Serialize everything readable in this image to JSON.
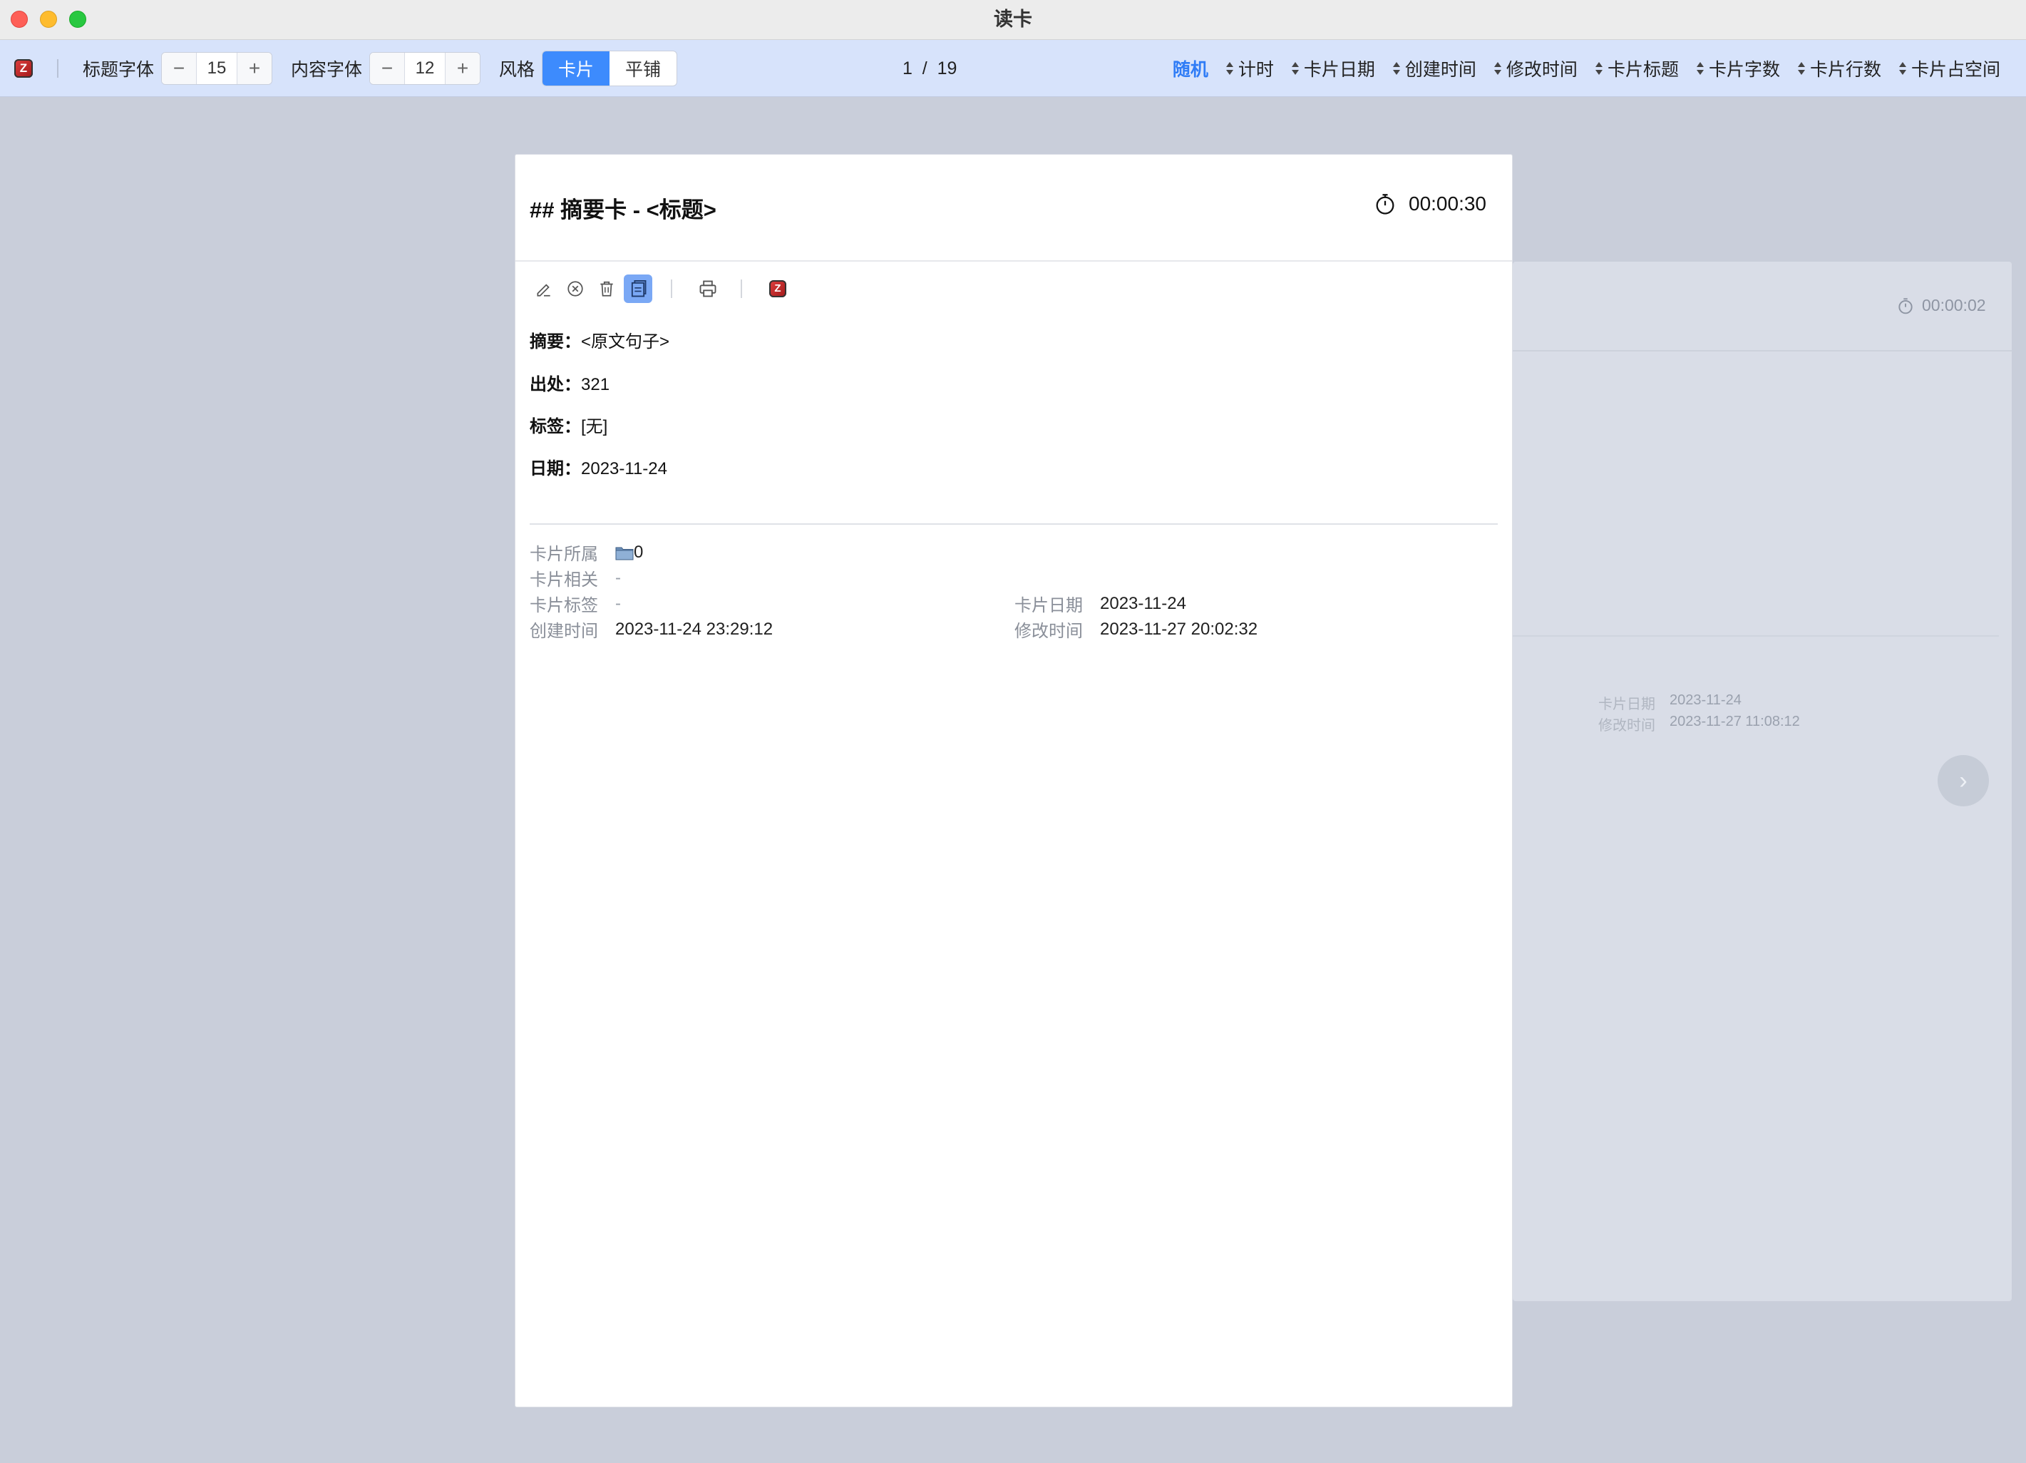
{
  "window": {
    "title": "读卡"
  },
  "toolbar": {
    "title_font_label": "标题字体",
    "title_font_value": "15",
    "content_font_label": "内容字体",
    "content_font_value": "12",
    "minus": "−",
    "plus": "+",
    "style_label": "风格",
    "style_options": [
      "卡片",
      "平铺"
    ],
    "style_selected": "卡片",
    "pager": "1  /  19",
    "sort": {
      "random": "随机",
      "items": [
        "计时",
        "卡片日期",
        "创建时间",
        "修改时间",
        "卡片标题",
        "卡片字数",
        "卡片行数",
        "卡片占空间"
      ]
    }
  },
  "card": {
    "title": "## 摘要卡 - <标题>",
    "timer": "00:00:30",
    "fields": [
      {
        "key": "摘要",
        "value": "<原文句子>"
      },
      {
        "key": "出处",
        "value": "321"
      },
      {
        "key": "标签",
        "value": "[无]"
      },
      {
        "key": "日期",
        "value": "2023-11-24"
      }
    ],
    "meta": {
      "belong_label": "卡片所属",
      "belong_value": "0",
      "related_label": "卡片相关",
      "related_value": "-",
      "tags_label": "卡片标签",
      "tags_value": "-",
      "date_label": "卡片日期",
      "date_value": "2023-11-24",
      "created_label": "创建时间",
      "created_value": "2023-11-24 23:29:12",
      "modified_label": "修改时间",
      "modified_value": "2023-11-27 20:02:32"
    }
  },
  "back_card": {
    "timer": "00:00:02",
    "date_label": "卡片日期",
    "date_value": "2023-11-24",
    "modified_label": "修改时间",
    "modified_value": "2023-11-27 11:08:12",
    "next": "›"
  },
  "colors": {
    "accent": "#3d8bfd",
    "toolbar_bg": "#d7e3fb",
    "page_bg": "#c9ceda"
  }
}
